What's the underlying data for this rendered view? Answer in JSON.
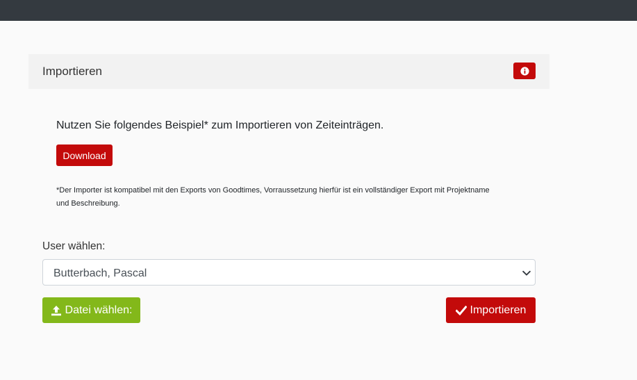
{
  "header": {
    "title": "Importieren",
    "info_icon": "info-circle-icon"
  },
  "intro": {
    "text": "Nutzen Sie folgendes Beispiel* zum Importieren von Zeiteinträgen.",
    "download_label": "Download",
    "note": "*Der Importer ist kompatibel mit den Exports von Goodtimes, Vorraussetzung hierfür ist ein vollständiger Export mit Projektname und Beschreibung."
  },
  "user": {
    "label": "User wählen:",
    "selected": "Butterbach, Pascal"
  },
  "actions": {
    "file_label": "Datei wählen:",
    "file_icon": "upload-icon",
    "import_label": "Importieren",
    "import_icon": "check-icon"
  },
  "colors": {
    "topbar": "#343a40",
    "primary_red": "#c30a0a",
    "green": "#83b81a"
  }
}
